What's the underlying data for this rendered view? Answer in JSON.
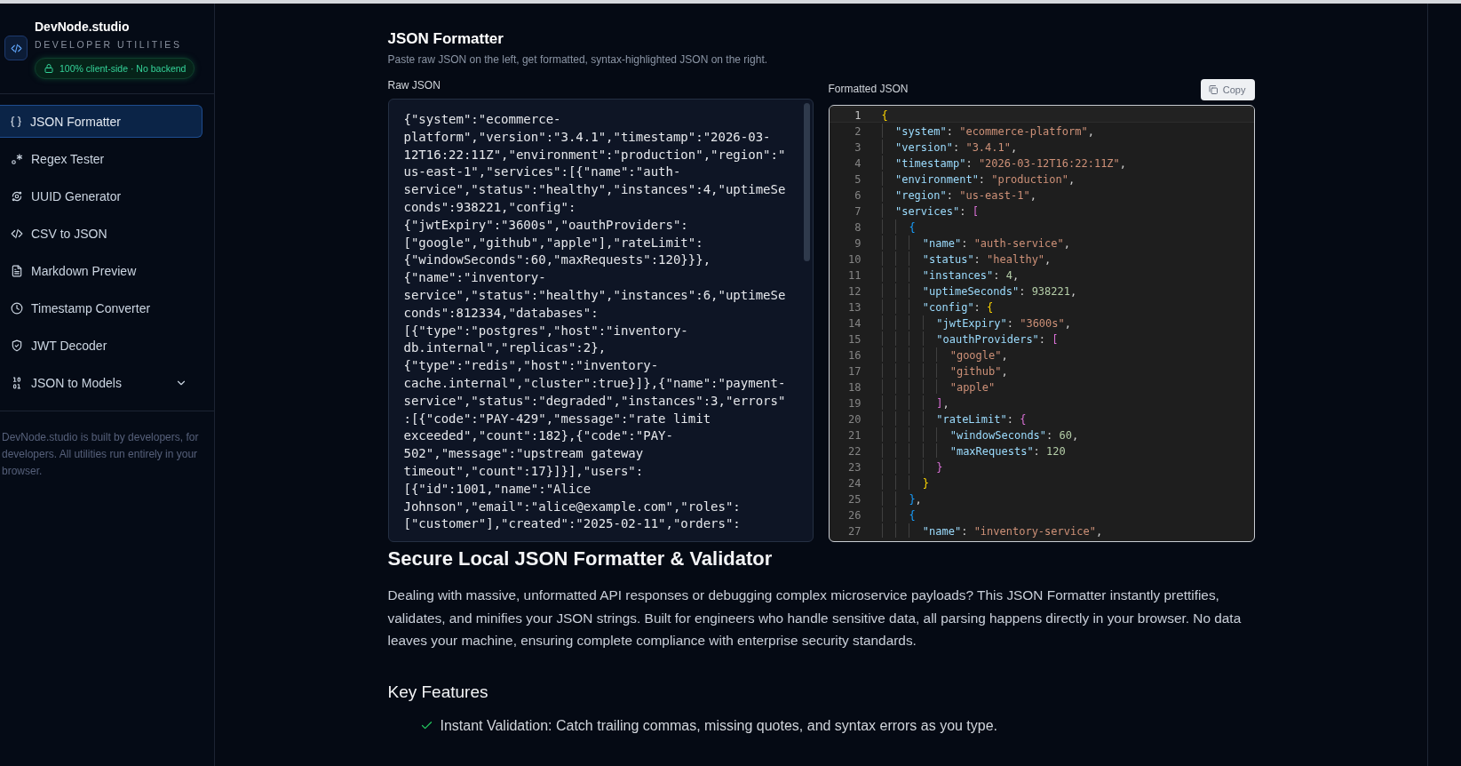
{
  "sidebar": {
    "brand": "DevNode.studio",
    "tagline": "DEVELOPER UTILITIES",
    "badge": "100% client-side · No backend",
    "items": [
      {
        "label": "JSON Formatter",
        "selected": true,
        "kind": "link"
      },
      {
        "label": "Regex Tester",
        "selected": false,
        "kind": "link"
      },
      {
        "label": "UUID Generator",
        "selected": false,
        "kind": "link"
      },
      {
        "label": "CSV to JSON",
        "selected": false,
        "kind": "link"
      },
      {
        "label": "Markdown Preview",
        "selected": false,
        "kind": "link"
      },
      {
        "label": "Timestamp Converter",
        "selected": false,
        "kind": "link"
      },
      {
        "label": "JWT Decoder",
        "selected": false,
        "kind": "link"
      },
      {
        "label": "JSON to Models",
        "selected": false,
        "kind": "group"
      }
    ],
    "footer": "DevNode.studio is built by developers, for developers. All utilities run entirely in your browser."
  },
  "tool": {
    "title": "JSON Formatter",
    "subtitle": "Paste raw JSON on the left, get formatted, syntax-highlighted JSON on the right.",
    "input": {
      "label": "Raw JSON",
      "value": "{\"system\":\"ecommerce-platform\",\"version\":\"3.4.1\",\"timestamp\":\"2026-03-12T16:22:11Z\",\"environment\":\"production\",\"region\":\"us-east-1\",\"services\":[{\"name\":\"auth-service\",\"status\":\"healthy\",\"instances\":4,\"uptimeSeconds\":938221,\"config\":{\"jwtExpiry\":\"3600s\",\"oauthProviders\":[\"google\",\"github\",\"apple\"],\"rateLimit\":{\"windowSeconds\":60,\"maxRequests\":120}}},{\"name\":\"inventory-service\",\"status\":\"healthy\",\"instances\":6,\"uptimeSeconds\":812334,\"databases\":[{\"type\":\"postgres\",\"host\":\"inventory-db.internal\",\"replicas\":2},{\"type\":\"redis\",\"host\":\"inventory-cache.internal\",\"cluster\":true}]},{\"name\":\"payment-service\",\"status\":\"degraded\",\"instances\":3,\"errors\":[{\"code\":\"PAY-429\",\"message\":\"rate limit exceeded\",\"count\":182},{\"code\":\"PAY-502\",\"message\":\"upstream gateway timeout\",\"count\":17}]}],\"users\":[{\"id\":1001,\"name\":\"Alice Johnson\",\"email\":\"alice@example.com\",\"roles\":[\"customer\"],\"created\":\"2025-02-11\",\"orders\":"
    },
    "output": {
      "label": "Formatted JSON",
      "copy_button": "Copy",
      "lines": [
        {
          "number": "1",
          "active": true,
          "tokens": [
            {
              "kind": "open",
              "text": "{"
            }
          ]
        },
        {
          "number": "2",
          "active": false,
          "tokens": [
            {
              "kind": "key",
              "text": "\"system\""
            },
            {
              "kind": "punct",
              "text": ": "
            },
            {
              "kind": "string",
              "text": "\"ecommerce-platform\""
            },
            {
              "kind": "punct",
              "text": ","
            }
          ]
        },
        {
          "number": "3",
          "active": false,
          "tokens": [
            {
              "kind": "key",
              "text": "\"version\""
            },
            {
              "kind": "punct",
              "text": ": "
            },
            {
              "kind": "string",
              "text": "\"3.4.1\""
            },
            {
              "kind": "punct",
              "text": ","
            }
          ]
        },
        {
          "number": "4",
          "active": false,
          "tokens": [
            {
              "kind": "key",
              "text": "\"timestamp\""
            },
            {
              "kind": "punct",
              "text": ": "
            },
            {
              "kind": "string",
              "text": "\"2026-03-12T16:22:11Z\""
            },
            {
              "kind": "punct",
              "text": ","
            }
          ]
        },
        {
          "number": "5",
          "active": false,
          "tokens": [
            {
              "kind": "key",
              "text": "\"environment\""
            },
            {
              "kind": "punct",
              "text": ": "
            },
            {
              "kind": "string",
              "text": "\"production\""
            },
            {
              "kind": "punct",
              "text": ","
            }
          ]
        },
        {
          "number": "6",
          "active": false,
          "tokens": [
            {
              "kind": "key",
              "text": "\"region\""
            },
            {
              "kind": "punct",
              "text": ": "
            },
            {
              "kind": "string",
              "text": "\"us-east-1\""
            },
            {
              "kind": "punct",
              "text": ","
            }
          ]
        },
        {
          "number": "7",
          "active": false,
          "tokens": [
            {
              "kind": "key",
              "text": "\"services\""
            },
            {
              "kind": "punct",
              "text": ": "
            },
            {
              "kind": "open",
              "text": "["
            }
          ]
        },
        {
          "number": "8",
          "active": false,
          "tokens": [
            {
              "kind": "open",
              "text": "{"
            }
          ]
        },
        {
          "number": "9",
          "active": false,
          "tokens": [
            {
              "kind": "key",
              "text": "\"name\""
            },
            {
              "kind": "punct",
              "text": ": "
            },
            {
              "kind": "string",
              "text": "\"auth-service\""
            },
            {
              "kind": "punct",
              "text": ","
            }
          ]
        },
        {
          "number": "10",
          "active": false,
          "tokens": [
            {
              "kind": "key",
              "text": "\"status\""
            },
            {
              "kind": "punct",
              "text": ": "
            },
            {
              "kind": "string",
              "text": "\"healthy\""
            },
            {
              "kind": "punct",
              "text": ","
            }
          ]
        },
        {
          "number": "11",
          "active": false,
          "tokens": [
            {
              "kind": "key",
              "text": "\"instances\""
            },
            {
              "kind": "punct",
              "text": ": "
            },
            {
              "kind": "number",
              "text": "4"
            },
            {
              "kind": "punct",
              "text": ","
            }
          ]
        },
        {
          "number": "12",
          "active": false,
          "tokens": [
            {
              "kind": "key",
              "text": "\"uptimeSeconds\""
            },
            {
              "kind": "punct",
              "text": ": "
            },
            {
              "kind": "number",
              "text": "938221"
            },
            {
              "kind": "punct",
              "text": ","
            }
          ]
        },
        {
          "number": "13",
          "active": false,
          "tokens": [
            {
              "kind": "key",
              "text": "\"config\""
            },
            {
              "kind": "punct",
              "text": ": "
            },
            {
              "kind": "open",
              "text": "{"
            }
          ]
        },
        {
          "number": "14",
          "active": false,
          "tokens": [
            {
              "kind": "key",
              "text": "\"jwtExpiry\""
            },
            {
              "kind": "punct",
              "text": ": "
            },
            {
              "kind": "string",
              "text": "\"3600s\""
            },
            {
              "kind": "punct",
              "text": ","
            }
          ]
        },
        {
          "number": "15",
          "active": false,
          "tokens": [
            {
              "kind": "key",
              "text": "\"oauthProviders\""
            },
            {
              "kind": "punct",
              "text": ": "
            },
            {
              "kind": "open",
              "text": "["
            }
          ]
        },
        {
          "number": "16",
          "active": false,
          "tokens": [
            {
              "kind": "string",
              "text": "\"google\""
            },
            {
              "kind": "punct",
              "text": ","
            }
          ]
        },
        {
          "number": "17",
          "active": false,
          "tokens": [
            {
              "kind": "string",
              "text": "\"github\""
            },
            {
              "kind": "punct",
              "text": ","
            }
          ]
        },
        {
          "number": "18",
          "active": false,
          "tokens": [
            {
              "kind": "string",
              "text": "\"apple\""
            }
          ]
        },
        {
          "number": "19",
          "active": false,
          "tokens": [
            {
              "kind": "close",
              "text": "]"
            },
            {
              "kind": "punct",
              "text": ","
            }
          ]
        },
        {
          "number": "20",
          "active": false,
          "tokens": [
            {
              "kind": "key",
              "text": "\"rateLimit\""
            },
            {
              "kind": "punct",
              "text": ": "
            },
            {
              "kind": "open",
              "text": "{"
            }
          ]
        },
        {
          "number": "21",
          "active": false,
          "tokens": [
            {
              "kind": "key",
              "text": "\"windowSeconds\""
            },
            {
              "kind": "punct",
              "text": ": "
            },
            {
              "kind": "number",
              "text": "60"
            },
            {
              "kind": "punct",
              "text": ","
            }
          ]
        },
        {
          "number": "22",
          "active": false,
          "tokens": [
            {
              "kind": "key",
              "text": "\"maxRequests\""
            },
            {
              "kind": "punct",
              "text": ": "
            },
            {
              "kind": "number",
              "text": "120"
            }
          ]
        },
        {
          "number": "23",
          "active": false,
          "tokens": [
            {
              "kind": "close",
              "text": "}"
            }
          ]
        },
        {
          "number": "24",
          "active": false,
          "tokens": [
            {
              "kind": "close",
              "text": "}"
            }
          ]
        },
        {
          "number": "25",
          "active": false,
          "tokens": [
            {
              "kind": "close",
              "text": "}"
            },
            {
              "kind": "punct",
              "text": ","
            }
          ]
        },
        {
          "number": "26",
          "active": false,
          "tokens": [
            {
              "kind": "open",
              "text": "{"
            }
          ]
        },
        {
          "number": "27",
          "active": false,
          "tokens": [
            {
              "kind": "key",
              "text": "\"name\""
            },
            {
              "kind": "punct",
              "text": ": "
            },
            {
              "kind": "string",
              "text": "\"inventory-service\""
            },
            {
              "kind": "punct",
              "text": ","
            }
          ]
        }
      ]
    }
  },
  "article": {
    "heading": "Secure Local JSON Formatter & Validator",
    "paragraph": "Dealing with massive, unformatted API responses or debugging complex microservice payloads? This JSON Formatter instantly prettifies, validates, and minifies your JSON strings. Built for engineers who handle sensitive data, all parsing happens directly in your browser. No data leaves your machine, ensuring complete compliance with enterprise security standards.",
    "features_heading": "Key Features",
    "features": [
      "Instant Validation: Catch trailing commas, missing quotes, and syntax errors as you type."
    ]
  }
}
